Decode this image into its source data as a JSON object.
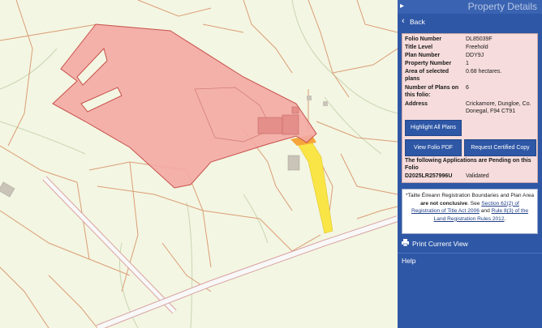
{
  "panel": {
    "title": "Property Details",
    "back_label": "Back",
    "toggle_glyph": "▸",
    "back_glyph": "‹",
    "details": {
      "rows": [
        {
          "key": "Folio Number",
          "value": "DL85039F"
        },
        {
          "key": "Title Level",
          "value": "Freehold"
        },
        {
          "key": "Plan Number",
          "value": "DDY9J"
        },
        {
          "key": "Property Number",
          "value": "1"
        },
        {
          "key": "Area of selected plans",
          "value": "0.68 hectares."
        },
        {
          "key": "Number of Plans on this folio:",
          "value": "6"
        },
        {
          "key": "Address",
          "value": "Crickamore, Dungloe, Co. Donegal, F94 CT91"
        }
      ],
      "highlight_label": "Highlight All Plans",
      "view_pdf_label": "View Folio PDF",
      "certified_copy_label": "Request Certified Copy",
      "pending_heading": "The following Applications are Pending on this Folio",
      "pending": [
        {
          "id": "D2025LR257996U",
          "status": "Validated"
        }
      ]
    },
    "notice": {
      "t1": "*Tailte Éireann Registration Boundaries and Plan Area ",
      "t2": "are not conclusive",
      "t3": ". See ",
      "link1": "Section 62(2) of Registration of Title Act 2006",
      "t4": " and ",
      "link2": "Rule 8(3) of the Land Registration Rules 2012",
      "t5": "."
    },
    "print_label": "Print Current View",
    "help_label": "Help"
  },
  "map": {
    "colors": {
      "background": "#f3f6e2",
      "parcel_fill": "#f2a9a3",
      "parcel_stroke": "#c84f49",
      "boundary": "#d99a70",
      "road": "#f7f7f7",
      "lane": "#f9e546",
      "building": "#c9c3b8",
      "hedge": "#c9d3b5"
    }
  }
}
